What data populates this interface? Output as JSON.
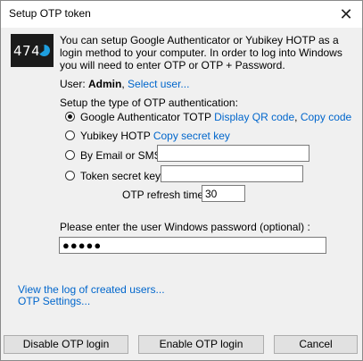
{
  "window": {
    "title": "Setup OTP token",
    "close_glyph": "✕"
  },
  "logo": {
    "text": "474",
    "icon": "token-dial-icon",
    "accent": "#1e9fe0"
  },
  "intro": "You can setup Google Authenticator or Yubikey HOTP as a login method to your computer. In order to log into Windows you will need to enter OTP or OTP + Password.",
  "user": {
    "label": "User:",
    "name": "Admin",
    "separator": ",",
    "select_link": "Select user..."
  },
  "setup_type_label": "Setup the type of OTP authentication:",
  "options": {
    "google": {
      "label": "Google Authenticator TOTP",
      "checked": true,
      "link1": "Display QR code",
      "separator": ",",
      "link2": "Copy code"
    },
    "yubikey": {
      "label": "Yubikey HOTP",
      "checked": false,
      "link": "Copy secret key"
    },
    "email": {
      "label": "By Email or SMS :",
      "checked": false,
      "value": ""
    },
    "token": {
      "label": "Token secret key:",
      "checked": false,
      "value": ""
    }
  },
  "refresh": {
    "label": "OTP refresh time:",
    "value": "30"
  },
  "password": {
    "label": "Please enter the user Windows password (optional) :",
    "value": "●●●●●"
  },
  "links": {
    "log": "View the log of created users...",
    "settings": "OTP Settings..."
  },
  "buttons": {
    "disable": "Disable OTP login",
    "enable": "Enable OTP login",
    "cancel": "Cancel"
  }
}
